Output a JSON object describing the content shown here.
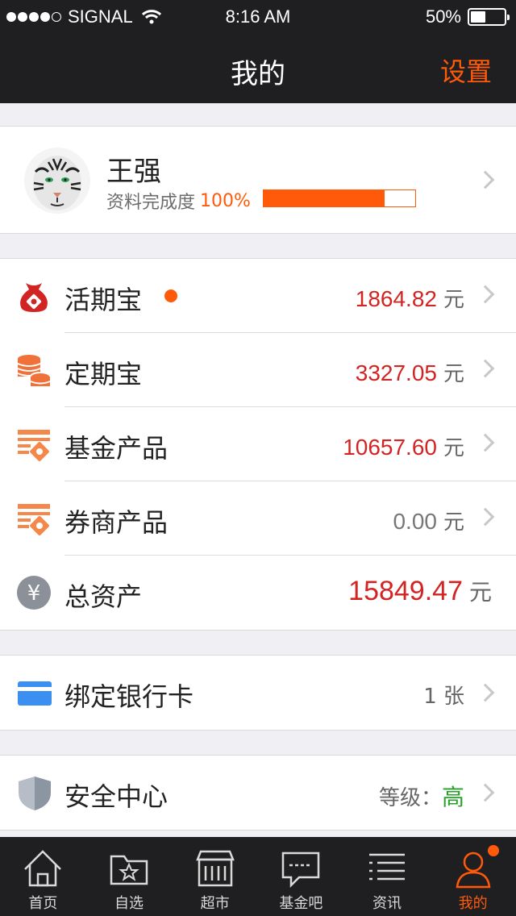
{
  "status_bar": {
    "carrier": "SIGNAL",
    "time": "8:16 AM",
    "battery_pct": "50%",
    "battery_level": 0.5
  },
  "nav": {
    "title": "我的",
    "settings_label": "设置"
  },
  "profile": {
    "name": "王强",
    "completeness_label": "资料完成度",
    "completeness_pct": "100%",
    "progress_fill": 0.8
  },
  "assets": {
    "items": [
      {
        "label": "活期宝",
        "amount": "1864.82",
        "unit": "元",
        "icon": "money-bag-icon",
        "has_dot": true
      },
      {
        "label": "定期宝",
        "amount": "3327.05",
        "unit": "元",
        "icon": "coins-stack-icon"
      },
      {
        "label": "基金产品",
        "amount": "10657.60",
        "unit": "元",
        "icon": "fund-product-icon"
      },
      {
        "label": "券商产品",
        "amount": "0.00",
        "unit": "元",
        "icon": "broker-product-icon"
      }
    ],
    "total": {
      "label": "总资产",
      "amount": "15849.47",
      "unit": "元",
      "icon": "yuan-icon"
    }
  },
  "bank_card": {
    "label": "绑定银行卡",
    "count": "1 张",
    "icon": "bank-card-icon"
  },
  "security": {
    "label": "安全中心",
    "level_label": "等级：",
    "level": "高",
    "icon": "shield-icon"
  },
  "tabs": [
    {
      "label": "首页",
      "icon": "home-icon"
    },
    {
      "label": "自选",
      "icon": "star-folder-icon"
    },
    {
      "label": "超市",
      "icon": "market-icon"
    },
    {
      "label": "基金吧",
      "icon": "chat-icon"
    },
    {
      "label": "资讯",
      "icon": "news-list-icon"
    },
    {
      "label": "我的",
      "icon": "person-icon",
      "active": true
    }
  ],
  "colors": {
    "accent": "#ff5a0a",
    "amount_red": "#d32424",
    "level_green": "#28a02c",
    "bank_blue": "#3b8ff0"
  }
}
